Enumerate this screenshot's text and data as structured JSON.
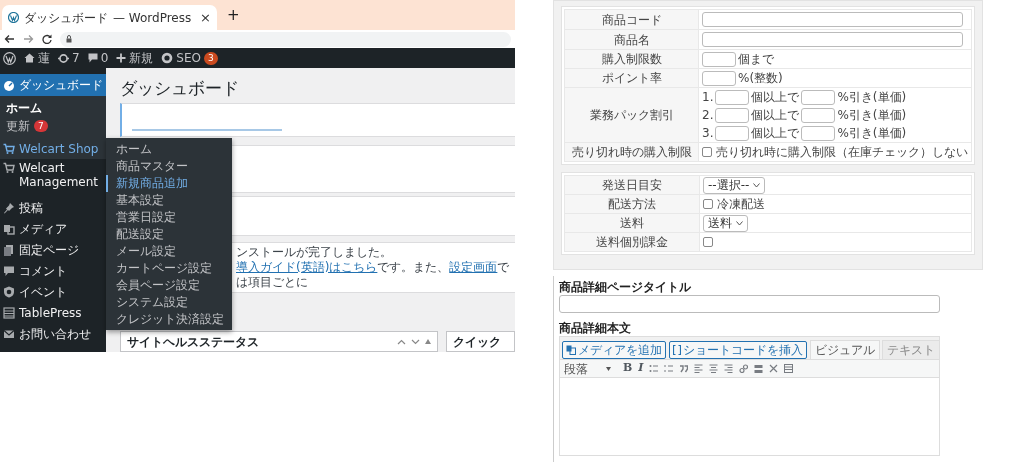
{
  "browser": {
    "tab_title": "ダッシュボード",
    "tab_suffix": "— WordPress",
    "close": "×",
    "new_tab": "+"
  },
  "admin_bar": {
    "site_name": "蓮",
    "updates": "7",
    "comments": "0",
    "new": "新規",
    "seo": "SEO",
    "seo_badge": "3"
  },
  "sidebar": [
    {
      "label": "ダッシュボード",
      "selected": true,
      "hovered": false,
      "children": [
        {
          "label": "ホーム",
          "selected": true
        },
        {
          "label": "更新",
          "selected": false,
          "badge": "7"
        }
      ]
    },
    {
      "label": "Welcart Shop",
      "selected": false,
      "hovered": true
    },
    {
      "label": "Welcart Management",
      "selected": false,
      "hovered": false
    },
    {
      "label": "投稿",
      "selected": false,
      "hovered": false
    },
    {
      "label": "メディア",
      "selected": false,
      "hovered": false
    },
    {
      "label": "固定ページ",
      "selected": false,
      "hovered": false
    },
    {
      "label": "コメント",
      "selected": false,
      "hovered": false
    },
    {
      "label": "イベント",
      "selected": false,
      "hovered": false
    },
    {
      "label": "TablePress",
      "selected": false,
      "hovered": false
    },
    {
      "label": "お問い合わせ",
      "selected": false,
      "hovered": false
    }
  ],
  "flyout": [
    {
      "label": "ホーム",
      "selected": false
    },
    {
      "label": "商品マスター",
      "selected": false
    },
    {
      "label": "新規商品追加",
      "selected": true
    },
    {
      "label": "基本設定",
      "selected": false
    },
    {
      "label": "営業日設定",
      "selected": false
    },
    {
      "label": "配送設定",
      "selected": false
    },
    {
      "label": "メール設定",
      "selected": false
    },
    {
      "label": "カートページ設定",
      "selected": false
    },
    {
      "label": "会員ページ設定",
      "selected": false
    },
    {
      "label": "システム設定",
      "selected": false
    },
    {
      "label": "クレジット決済設定",
      "selected": false
    }
  ],
  "page_title": "ダッシュボード",
  "notice": [
    {
      "kind": "text",
      "text": "ンストールが完了しました。"
    },
    {
      "kind": "link",
      "text": "導入ガイド(英語)はこちら"
    },
    {
      "kind": "text",
      "text": "です。また、"
    },
    {
      "kind": "link",
      "text": "設定画面"
    },
    {
      "kind": "text",
      "text": "では項目ごとに"
    }
  ],
  "postboxes": [
    {
      "title": "サイトヘルスステータス",
      "handles": true
    },
    {
      "title": "クイック",
      "handles": false
    }
  ],
  "item_form": [
    {
      "rows": [
        {
          "kind": "text",
          "label": "商品コード"
        },
        {
          "kind": "text",
          "label": "商品名"
        },
        {
          "kind": "number",
          "label": "購入制限数",
          "suffix": "個まで"
        },
        {
          "kind": "number",
          "label": "ポイント率",
          "suffix": "%(整数)"
        },
        {
          "kind": "tiers",
          "label": "業務パック割引",
          "tiers": [
            {
              "index": "1.",
              "middle": "個以上で",
              "suffix": "%引き(単価)"
            },
            {
              "index": "2.",
              "middle": "個以上で",
              "suffix": "%引き(単価)"
            },
            {
              "index": "3.",
              "middle": "個以上で",
              "suffix": "%引き(単価)"
            }
          ]
        },
        {
          "kind": "checkbox",
          "label": "売り切れ時の購入制限",
          "checked": false,
          "text": "売り切れ時に購入制限（在庫チェック）しない"
        }
      ]
    },
    {
      "rows": [
        {
          "kind": "select",
          "label": "発送日目安",
          "value": "--選択--"
        },
        {
          "kind": "checkbox",
          "label": "配送方法",
          "checked": false,
          "text": "冷凍配送"
        },
        {
          "kind": "select",
          "label": "送料",
          "value": "送料"
        },
        {
          "kind": "checkbox",
          "label": "送料個別課金",
          "checked": false
        }
      ]
    }
  ],
  "editor": {
    "title_label": "商品詳細ページタイトル",
    "body_label": "商品詳細本文",
    "buttons": [
      {
        "label": "メディアを追加"
      },
      {
        "label": "ショートコードを挿入"
      }
    ],
    "tabs": [
      {
        "label": "ビジュアル",
        "selected": true
      },
      {
        "label": "テキスト",
        "selected": false
      }
    ],
    "format": "段落",
    "bold": "B",
    "italic": "I"
  }
}
